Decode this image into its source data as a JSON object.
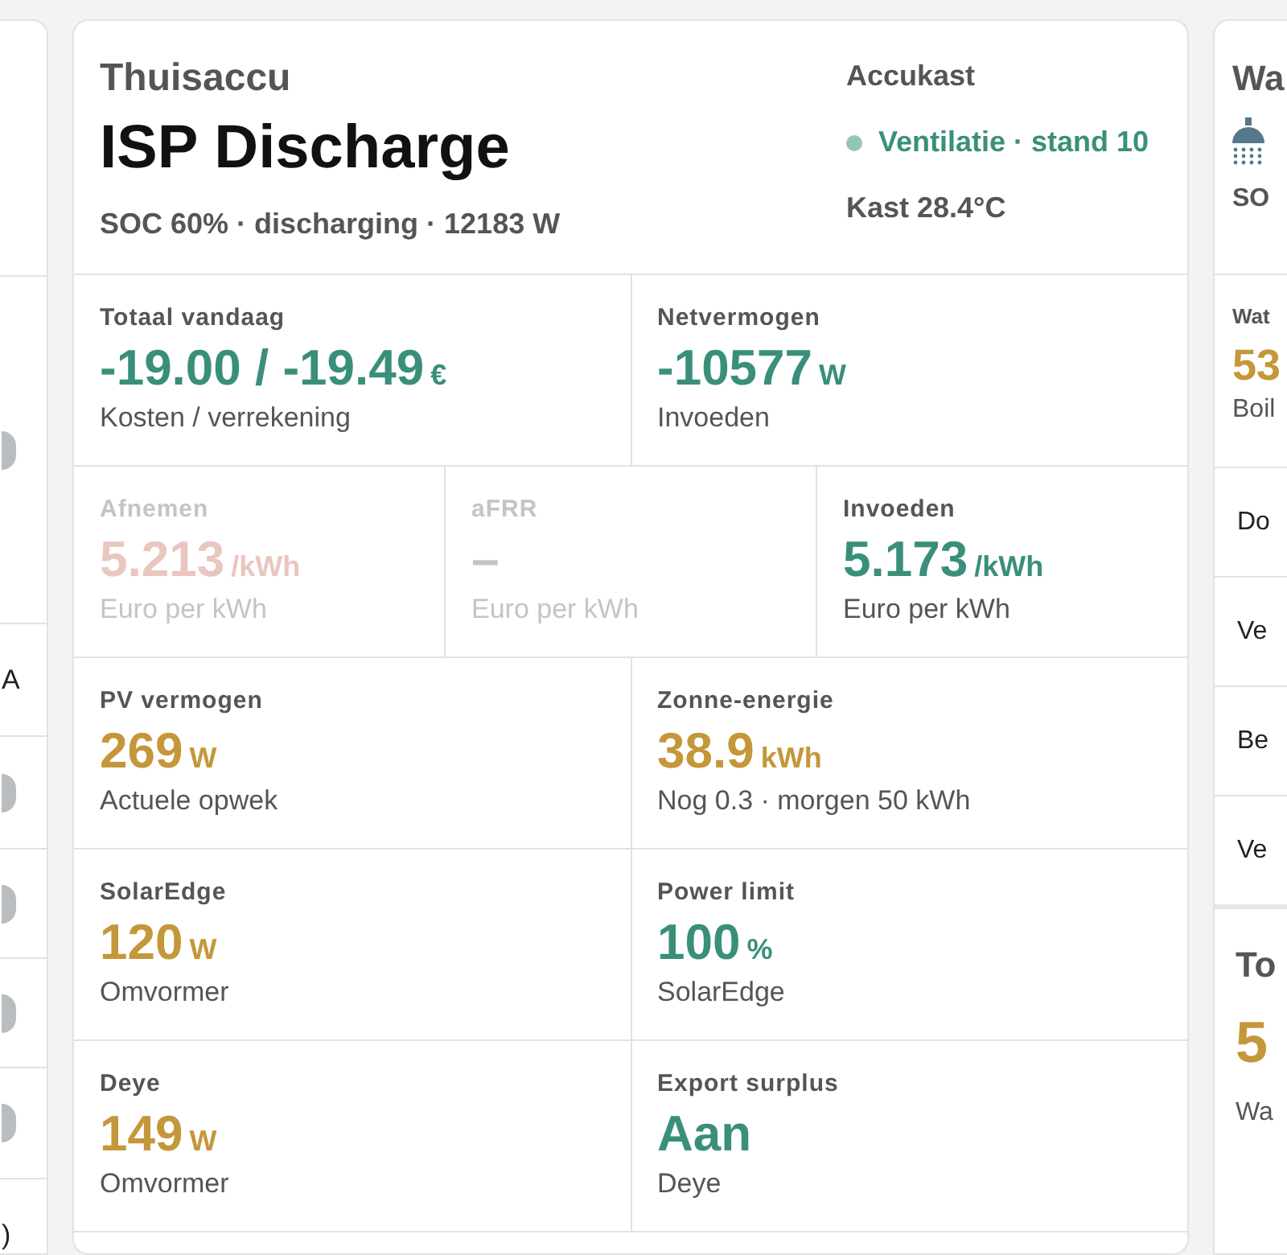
{
  "left_card": {
    "rows": [
      {
        "kind": "knob"
      },
      {
        "kind": "text",
        "text": "A"
      },
      {
        "kind": "knob"
      },
      {
        "kind": "knob"
      },
      {
        "kind": "knob"
      },
      {
        "kind": "knob"
      },
      {
        "kind": "text",
        "text": ")"
      }
    ]
  },
  "main_card": {
    "subtitle": "Thuisaccu",
    "title": "ISP Discharge",
    "status": "SOC 60% · discharging · 12183 W",
    "aside": {
      "title": "Accukast",
      "indicator": "Ventilatie · stand 10",
      "reading": "Kast 28.4°C"
    },
    "metric_rows": [
      [
        {
          "label": "Totaal vandaag",
          "value": "-19.00 / -19.49",
          "unit": "€",
          "sub": "Kosten / verrekening",
          "color": "#3a8f7a",
          "disabled": false
        },
        {
          "label": "Netvermogen",
          "value": "-10577",
          "unit": "W",
          "sub": "Invoeden",
          "color": "#3a8f7a",
          "disabled": false
        }
      ],
      [
        {
          "label": "Afnemen",
          "value": "5.213",
          "unit": "/kWh",
          "sub": "Euro per kWh",
          "color": "#e9c6bf",
          "disabled": true
        },
        {
          "label": "aFRR",
          "value": "–",
          "sub": "Euro per kWh",
          "color": "#c4c4c4",
          "disabled": true
        },
        {
          "label": "Invoeden",
          "value": "5.173",
          "unit": "/kWh",
          "sub": "Euro per kWh",
          "color": "#3a8f7a",
          "disabled": false
        }
      ],
      [
        {
          "label": "PV vermogen",
          "value": "269",
          "unit": "W",
          "sub": "Actuele opwek",
          "color": "#c4973a",
          "disabled": false
        },
        {
          "label": "Zonne-energie",
          "value": "38.9",
          "unit": "kWh",
          "sub": "Nog 0.3 · morgen 50 kWh",
          "color": "#c4973a",
          "disabled": false
        }
      ],
      [
        {
          "label": "SolarEdge",
          "value": "120",
          "unit": "W",
          "sub": "Omvormer",
          "color": "#c4973a",
          "disabled": false
        },
        {
          "label": "Power limit",
          "value": "100",
          "unit": "%",
          "sub": "SolarEdge",
          "color": "#3a8f7a",
          "disabled": false
        }
      ],
      [
        {
          "label": "Deye",
          "value": "149",
          "unit": "W",
          "sub": "Omvormer",
          "color": "#c4973a",
          "disabled": false
        },
        {
          "label": "Export surplus",
          "value": "Aan",
          "sub": "Deye",
          "color": "#3a8f7a",
          "disabled": false
        }
      ]
    ]
  },
  "right_card": {
    "title": "Wa",
    "status": "SO",
    "metric": {
      "label": "Wat",
      "value": "53",
      "sub": "Boil"
    },
    "rows": [
      "Do",
      "Ve",
      "Be",
      "Ve"
    ],
    "section": {
      "title": "To",
      "value": "5",
      "sub": "Wa"
    }
  }
}
